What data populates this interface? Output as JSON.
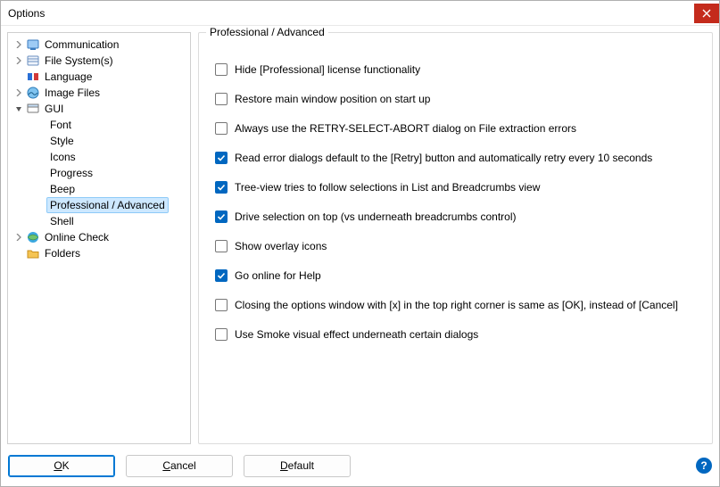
{
  "window": {
    "title": "Options"
  },
  "tree": {
    "items": [
      {
        "label": "Communication",
        "level": 0,
        "expander": "closed",
        "icon": "comm"
      },
      {
        "label": "File System(s)",
        "level": 0,
        "expander": "closed",
        "icon": "fs"
      },
      {
        "label": "Language",
        "level": 0,
        "expander": "none",
        "icon": "lang"
      },
      {
        "label": "Image Files",
        "level": 0,
        "expander": "closed",
        "icon": "img"
      },
      {
        "label": "GUI",
        "level": 0,
        "expander": "open",
        "icon": "gui"
      },
      {
        "label": "Font",
        "level": 1,
        "expander": "none",
        "icon": ""
      },
      {
        "label": "Style",
        "level": 1,
        "expander": "none",
        "icon": ""
      },
      {
        "label": "Icons",
        "level": 1,
        "expander": "none",
        "icon": ""
      },
      {
        "label": "Progress",
        "level": 1,
        "expander": "none",
        "icon": ""
      },
      {
        "label": "Beep",
        "level": 1,
        "expander": "none",
        "icon": ""
      },
      {
        "label": "Professional / Advanced",
        "level": 1,
        "expander": "none",
        "icon": "",
        "selected": true
      },
      {
        "label": "Shell",
        "level": 1,
        "expander": "none",
        "icon": ""
      },
      {
        "label": "Online Check",
        "level": 0,
        "expander": "closed",
        "icon": "online"
      },
      {
        "label": "Folders",
        "level": 0,
        "expander": "none",
        "icon": "folder"
      }
    ]
  },
  "panel": {
    "title": "Professional / Advanced",
    "options": [
      {
        "label": "Hide [Professional] license functionality",
        "checked": false
      },
      {
        "label": "Restore main window position on start up",
        "checked": false
      },
      {
        "label": "Always use the RETRY-SELECT-ABORT dialog on File extraction errors",
        "checked": false
      },
      {
        "label": "Read error dialogs default to the [Retry] button and automatically retry every 10 seconds",
        "checked": true
      },
      {
        "label": "Tree-view tries to follow selections in List and Breadcrumbs view",
        "checked": true
      },
      {
        "label": "Drive selection on top (vs underneath breadcrumbs control)",
        "checked": true
      },
      {
        "label": "Show overlay icons",
        "checked": false
      },
      {
        "label": "Go online for Help",
        "checked": true
      },
      {
        "label": "Closing the options window with [x] in the top right corner is same as [OK], instead of [Cancel]",
        "checked": false
      },
      {
        "label": "Use Smoke visual effect underneath certain dialogs",
        "checked": false
      }
    ]
  },
  "buttons": {
    "ok": "OK",
    "cancel": "Cancel",
    "default": "Default"
  }
}
